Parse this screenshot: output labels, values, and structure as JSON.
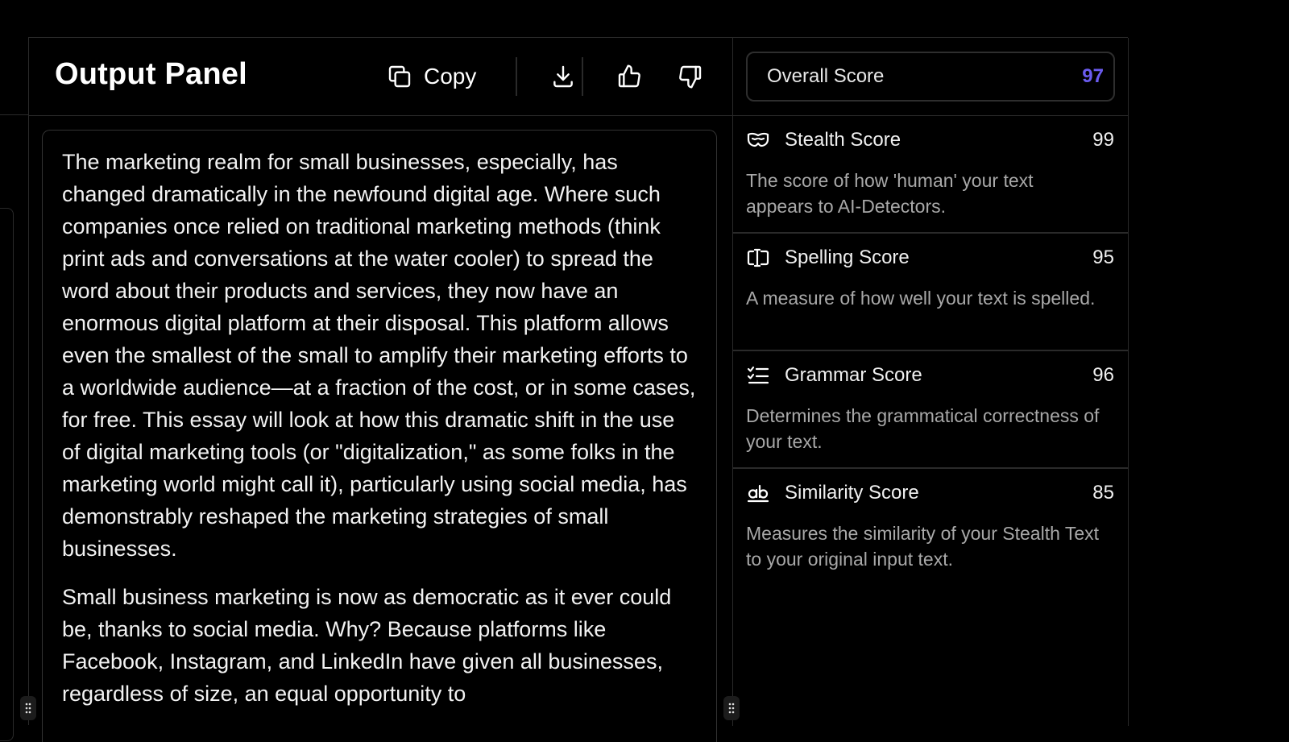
{
  "output_panel": {
    "title": "Output Panel",
    "copy_label": "Copy",
    "paragraphs": [
      "The marketing realm for small businesses, especially, has changed dramatically in the newfound digital age. Where such companies once relied on traditional marketing methods (think print ads and conversations at the water cooler) to spread the word about their products and services, they now have an enormous digital platform at their disposal. This platform allows even the smallest of the small to amplify their marketing efforts to a worldwide audience—at a fraction of the cost, or in some cases, for free. This essay will look at how this dramatic shift in the use of digital marketing tools (or \"digitalization,\" as some folks in the marketing world might call it), particularly using social media, has demonstrably reshaped the marketing strategies of small businesses.",
      "Small business marketing is now as democratic as it ever could be, thanks to social media. Why? Because platforms like Facebook, Instagram, and LinkedIn have given all businesses, regardless of size, an equal opportunity to"
    ]
  },
  "scores": {
    "overall": {
      "label": "Overall Score",
      "value": "97",
      "value_color": "#6b5cf0"
    },
    "items": [
      {
        "icon": "mask-icon",
        "name": "Stealth Score",
        "value": "99",
        "desc": "The score of how 'human' your text appears to AI-Detectors."
      },
      {
        "icon": "text-cursor-icon",
        "name": "Spelling Score",
        "value": "95",
        "desc": "A measure of how well your text is spelled."
      },
      {
        "icon": "checklist-icon",
        "name": "Grammar Score",
        "value": "96",
        "desc": "Determines the grammatical correctness of your text."
      },
      {
        "icon": "ab-icon",
        "name": "Similarity Score",
        "value": "85",
        "desc": "Measures the similarity of your Stealth Text to your original input text."
      }
    ]
  }
}
